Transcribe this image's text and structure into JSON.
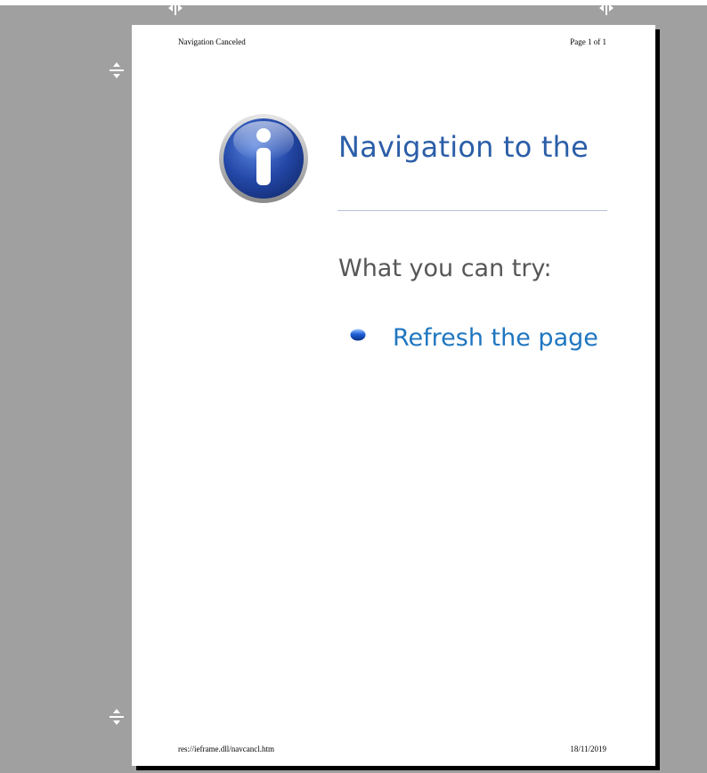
{
  "page": {
    "header_title": "Navigation Canceled",
    "header_page": "Page 1 of 1",
    "footer_url": "res://ieframe.dll/navcancl.htm",
    "footer_date": "18/11/2019"
  },
  "content": {
    "heading": "Navigation to the",
    "subheading": "What you can try:",
    "action_link": "Refresh the page"
  },
  "icons": {
    "info": "info-icon",
    "bullet": "blue-bullet-icon",
    "margin_handles": [
      "left-margin-handle",
      "right-margin-handle",
      "top-margin-handle",
      "bottom-margin-handle"
    ]
  },
  "colors": {
    "background": "#a0a0a0",
    "heading": "#2b5ea8",
    "subheading": "#575757",
    "link": "#1f76c0"
  }
}
